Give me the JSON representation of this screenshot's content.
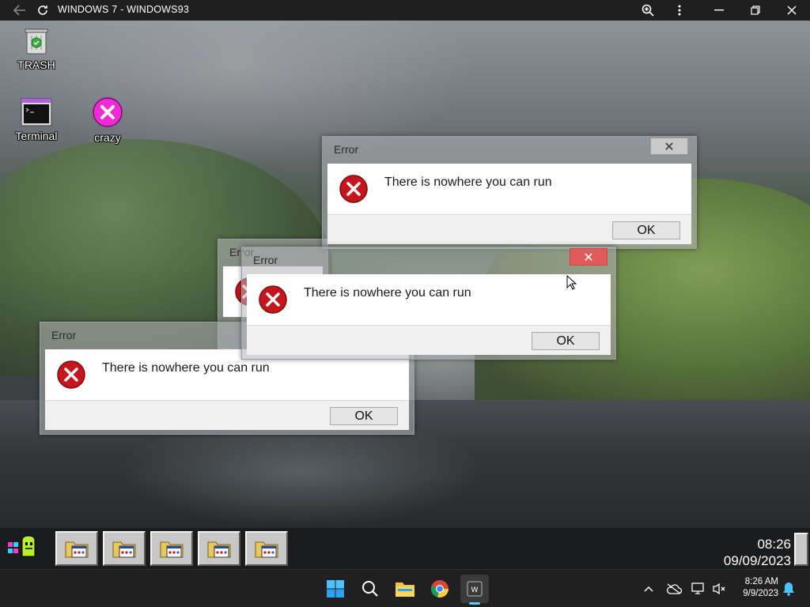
{
  "host_window": {
    "title": "WINDOWS 7 - WINDOWS93",
    "icons": [
      "back-arrow-icon",
      "refresh-icon",
      "zoom-icon",
      "more-menu-icon",
      "minimize-icon",
      "restore-icon",
      "close-icon"
    ]
  },
  "desktop": {
    "icons": [
      {
        "label": "TRASH",
        "icon": "trash-icon"
      },
      {
        "label": "Terminal",
        "icon": "terminal-icon"
      },
      {
        "label": "crazy",
        "icon": "crazy-icon"
      }
    ]
  },
  "dialogs": [
    {
      "title": "Error",
      "message": "There is nowhere you can run",
      "ok_label": "OK",
      "icon": "error-icon"
    },
    {
      "title": "Error",
      "message": "There is nowhere you can run",
      "ok_label": "OK",
      "icon": "error-icon"
    },
    {
      "title": "Error",
      "message": "There is nowhere you can run",
      "ok_label": "OK",
      "icon": "error-icon"
    },
    {
      "title": "Error",
      "message": "There is nowhere you can run",
      "ok_label": "OK",
      "icon": "error-icon"
    }
  ],
  "w93_taskbar": {
    "start_icon": "w93-start-icon",
    "task_buttons": 5,
    "task_icon": "error-window-icon",
    "clock_time": "08:26",
    "clock_date": "09/09/2023"
  },
  "host_taskbar": {
    "apps": [
      "windows-start-icon",
      "search-icon",
      "file-explorer-icon",
      "chrome-icon",
      "windows93-app-icon"
    ],
    "tray": [
      "chevron-up-icon",
      "cloud-off-icon",
      "network-icon",
      "volume-mute-icon",
      "notification-bell-icon"
    ],
    "time": "8:26 AM",
    "date": "9/9/2023"
  },
  "colors": {
    "accent": "#60cdff",
    "close_hot": "#e05b5b",
    "error_red": "#c4161c"
  }
}
